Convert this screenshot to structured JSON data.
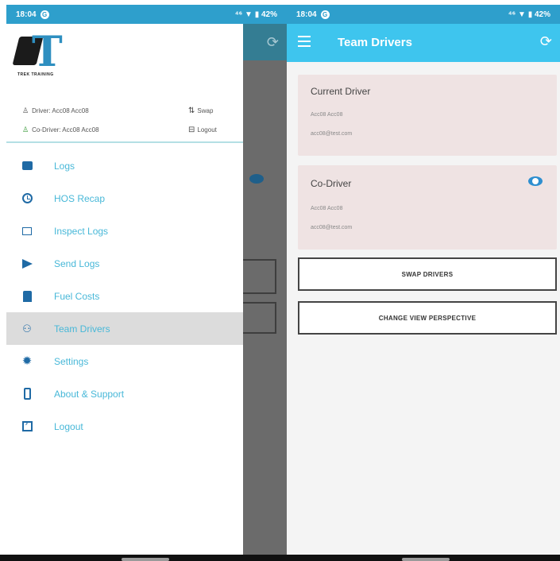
{
  "left_status": {
    "time": "18:04",
    "right": "⁴⁶ ▼ ▮ 42%"
  },
  "right_status": {
    "time": "18:04",
    "right": "⁴⁶ ▼ ▮ 42%"
  },
  "drawer": {
    "logo_text": "TREK TRAINING",
    "driver_label": "Driver: Acc08 Acc08",
    "codriver_label": "Co-Driver: Acc08 Acc08",
    "swap_label": "Swap",
    "logout_label": "Logout",
    "items": [
      {
        "label": "Logs",
        "icon": "logs-icon"
      },
      {
        "label": "HOS Recap",
        "icon": "clock-icon"
      },
      {
        "label": "Inspect Logs",
        "icon": "inspect-icon"
      },
      {
        "label": "Send Logs",
        "icon": "send-icon"
      },
      {
        "label": "Fuel Costs",
        "icon": "fuel-icon"
      },
      {
        "label": "Team Drivers",
        "icon": "people-icon"
      },
      {
        "label": "Settings",
        "icon": "gear-icon"
      },
      {
        "label": "About & Support",
        "icon": "phone-icon"
      },
      {
        "label": "Logout",
        "icon": "exit-icon"
      }
    ],
    "active_index": 5
  },
  "team_drivers": {
    "title": "Team Drivers",
    "current_driver": {
      "heading": "Current Driver",
      "name": "Acc08 Acc08",
      "email": "acc08@test.com"
    },
    "co_driver": {
      "heading": "Co-Driver",
      "name": "Acc08 Acc08",
      "email": "acc08@test.com"
    },
    "swap_button": "SWAP DRIVERS",
    "perspective_button": "CHANGE VIEW PERSPECTIVE"
  },
  "colors": {
    "accent": "#3ec5ee",
    "status_bar": "#2e9fcc",
    "menu_icon": "#1f6aa5",
    "card_bg": "#efe3e3"
  }
}
